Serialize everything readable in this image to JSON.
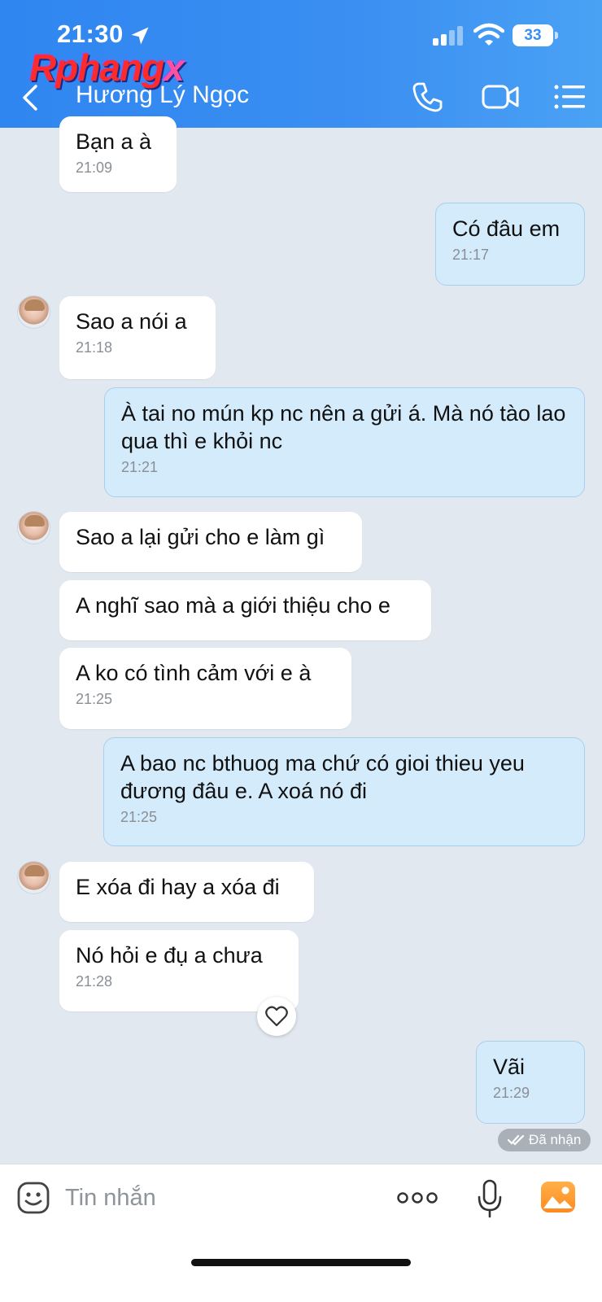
{
  "status_bar": {
    "time": "21:30",
    "battery": "33"
  },
  "watermark": {
    "text": "Rphang",
    "x": "x"
  },
  "header": {
    "contact_name": "Hương Lý Ngọc"
  },
  "messages": [
    {
      "text": "Bạn a à",
      "time": "21:09"
    },
    {
      "text": "Có đâu em",
      "time": "21:17"
    },
    {
      "text": "Sao a nói a",
      "time": "21:18"
    },
    {
      "text": "À tai no mún kp nc nên a gửi á. Mà nó tào lao qua thì e khỏi nc",
      "time": "21:21"
    },
    {
      "text": "Sao a lại gửi cho e làm gì"
    },
    {
      "text": "A nghĩ sao mà a giới thiệu cho e"
    },
    {
      "text": "A ko có tình cảm với e à",
      "time": "21:25"
    },
    {
      "text": "A bao nc bthuog ma chứ có gioi thieu yeu đương đâu e. A xoá nó đi",
      "time": "21:25"
    },
    {
      "text": "E  xóa đi hay a xóa đi"
    },
    {
      "text": "Nó hỏi e đụ a chưa",
      "time": "21:28"
    },
    {
      "text": "Vãi",
      "time": "21:29"
    }
  ],
  "received_status": "Đã nhận",
  "composer": {
    "placeholder": "Tin nhắn"
  },
  "colors": {
    "header": "#3a8ff1",
    "outgoing_bubble": "#d4ebfb",
    "incoming_bubble": "#ffffff",
    "chat_bg": "#e2e8f0",
    "photo_accent": "#ff9a2e"
  },
  "icons": [
    "location-arrow-icon",
    "signal-icon",
    "wifi-icon",
    "battery-icon",
    "back-icon",
    "phone-icon",
    "video-icon",
    "menu-icon",
    "heart-icon",
    "double-check-icon",
    "sticker-icon",
    "more-icon",
    "mic-icon",
    "photo-icon"
  ]
}
